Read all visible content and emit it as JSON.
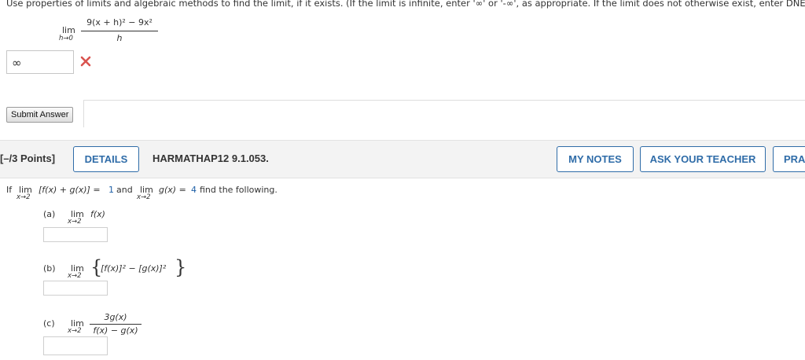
{
  "question1": {
    "instructions": "Use properties of limits and algebraic methods to find the limit, if it exists. (If the limit is infinite, enter '∞' or '-∞', as appropriate. If the limit does not otherwise exist, enter DNE.)",
    "lim_word": "lim",
    "lim_sub": "h→0",
    "numerator": "9(x + h)² − 9x²",
    "denominator": "h",
    "answer_value": "∞",
    "submit_label": "Submit Answer"
  },
  "question2": {
    "points": "[–/3 Points]",
    "details_label": "DETAILS",
    "code": "HARMATHAP12 9.1.053.",
    "my_notes_label": "MY NOTES",
    "ask_teacher_label": "ASK YOUR TEACHER",
    "practice_label": "PRA",
    "prompt_if": "If",
    "lim_word": "lim",
    "lim_sub": "x→2",
    "prompt_expr1": "[f(x) + g(x)] =",
    "value1": "1",
    "prompt_and": "and",
    "prompt_expr2": "g(x) =",
    "value2": "4",
    "prompt_tail": "find the following.",
    "parts": [
      {
        "label": "(a)",
        "expr": "f(x)"
      },
      {
        "label": "(b)",
        "expr": "[f(x)]² − [g(x)]²"
      },
      {
        "label": "(c)",
        "numerator": "3g(x)",
        "denominator": "f(x) − g(x)"
      }
    ]
  },
  "colors": {
    "accent_blue": "#2f6ca8",
    "error_red": "#d9534f",
    "band_gray": "#f3f3f3"
  },
  "icons": {
    "incorrect": "x-mark-icon"
  }
}
